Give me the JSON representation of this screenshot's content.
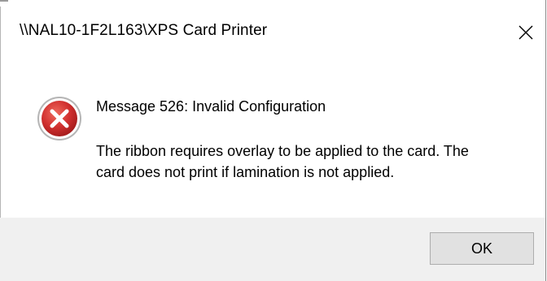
{
  "window": {
    "title": "\\\\NAL10-1F2L163\\XPS Card Printer",
    "close_icon": "close-icon"
  },
  "message": {
    "icon": "error-icon",
    "icon_color": "#d1302f",
    "heading": "Message 526: Invalid Configuration",
    "body_line1": "The ribbon requires overlay to be applied to the card. The",
    "body_line2": "card does not print if lamination is not applied."
  },
  "buttons": {
    "ok_label": "OK"
  },
  "colors": {
    "footer_bg": "#f0f0f0",
    "button_bg": "#e1e1e1"
  }
}
